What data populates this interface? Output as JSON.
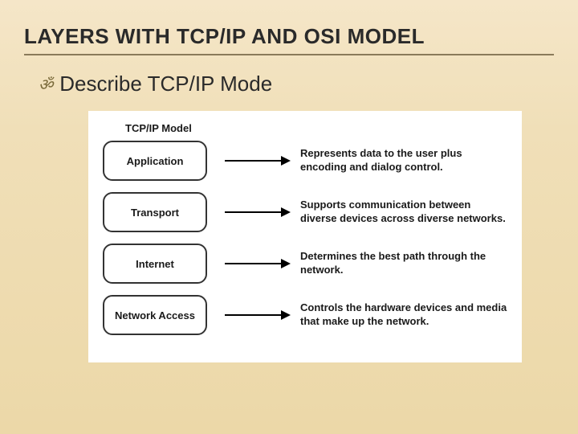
{
  "title": "LAYERS WITH TCP/IP AND OSI MODEL",
  "bullet": "Describe TCP/IP Mode",
  "diagram": {
    "model_title": "TCP/IP Model",
    "layers": [
      {
        "name": "Application",
        "description": "Represents data to the user plus encoding and dialog control."
      },
      {
        "name": "Transport",
        "description": "Supports communication between diverse devices across diverse networks."
      },
      {
        "name": "Internet",
        "description": "Determines the best path through the network."
      },
      {
        "name": "Network Access",
        "description": "Controls the hardware devices and media that make up the network."
      }
    ]
  }
}
